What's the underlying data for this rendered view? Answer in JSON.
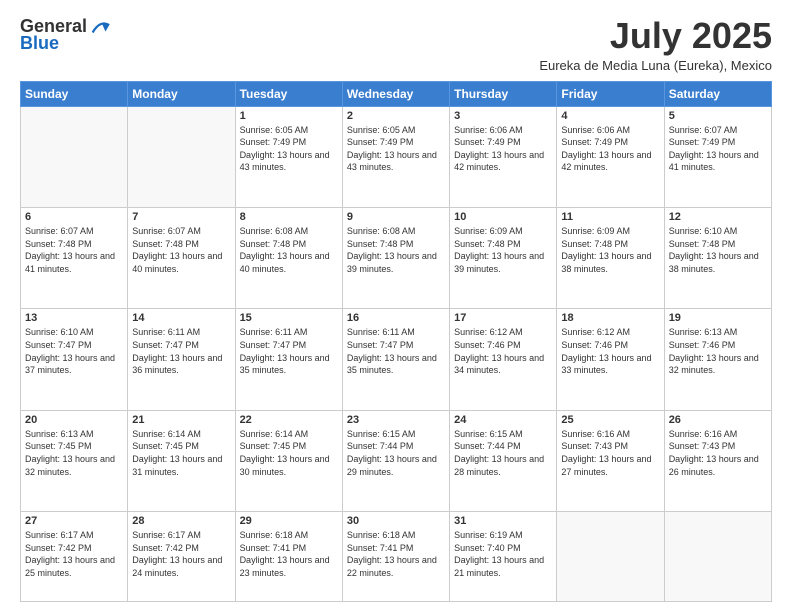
{
  "header": {
    "logo_general": "General",
    "logo_blue": "Blue",
    "month_title": "July 2025",
    "location": "Eureka de Media Luna (Eureka), Mexico"
  },
  "days_of_week": [
    "Sunday",
    "Monday",
    "Tuesday",
    "Wednesday",
    "Thursday",
    "Friday",
    "Saturday"
  ],
  "weeks": [
    [
      {
        "day": "",
        "info": ""
      },
      {
        "day": "",
        "info": ""
      },
      {
        "day": "1",
        "info": "Sunrise: 6:05 AM\nSunset: 7:49 PM\nDaylight: 13 hours and 43 minutes."
      },
      {
        "day": "2",
        "info": "Sunrise: 6:05 AM\nSunset: 7:49 PM\nDaylight: 13 hours and 43 minutes."
      },
      {
        "day": "3",
        "info": "Sunrise: 6:06 AM\nSunset: 7:49 PM\nDaylight: 13 hours and 42 minutes."
      },
      {
        "day": "4",
        "info": "Sunrise: 6:06 AM\nSunset: 7:49 PM\nDaylight: 13 hours and 42 minutes."
      },
      {
        "day": "5",
        "info": "Sunrise: 6:07 AM\nSunset: 7:49 PM\nDaylight: 13 hours and 41 minutes."
      }
    ],
    [
      {
        "day": "6",
        "info": "Sunrise: 6:07 AM\nSunset: 7:48 PM\nDaylight: 13 hours and 41 minutes."
      },
      {
        "day": "7",
        "info": "Sunrise: 6:07 AM\nSunset: 7:48 PM\nDaylight: 13 hours and 40 minutes."
      },
      {
        "day": "8",
        "info": "Sunrise: 6:08 AM\nSunset: 7:48 PM\nDaylight: 13 hours and 40 minutes."
      },
      {
        "day": "9",
        "info": "Sunrise: 6:08 AM\nSunset: 7:48 PM\nDaylight: 13 hours and 39 minutes."
      },
      {
        "day": "10",
        "info": "Sunrise: 6:09 AM\nSunset: 7:48 PM\nDaylight: 13 hours and 39 minutes."
      },
      {
        "day": "11",
        "info": "Sunrise: 6:09 AM\nSunset: 7:48 PM\nDaylight: 13 hours and 38 minutes."
      },
      {
        "day": "12",
        "info": "Sunrise: 6:10 AM\nSunset: 7:48 PM\nDaylight: 13 hours and 38 minutes."
      }
    ],
    [
      {
        "day": "13",
        "info": "Sunrise: 6:10 AM\nSunset: 7:47 PM\nDaylight: 13 hours and 37 minutes."
      },
      {
        "day": "14",
        "info": "Sunrise: 6:11 AM\nSunset: 7:47 PM\nDaylight: 13 hours and 36 minutes."
      },
      {
        "day": "15",
        "info": "Sunrise: 6:11 AM\nSunset: 7:47 PM\nDaylight: 13 hours and 35 minutes."
      },
      {
        "day": "16",
        "info": "Sunrise: 6:11 AM\nSunset: 7:47 PM\nDaylight: 13 hours and 35 minutes."
      },
      {
        "day": "17",
        "info": "Sunrise: 6:12 AM\nSunset: 7:46 PM\nDaylight: 13 hours and 34 minutes."
      },
      {
        "day": "18",
        "info": "Sunrise: 6:12 AM\nSunset: 7:46 PM\nDaylight: 13 hours and 33 minutes."
      },
      {
        "day": "19",
        "info": "Sunrise: 6:13 AM\nSunset: 7:46 PM\nDaylight: 13 hours and 32 minutes."
      }
    ],
    [
      {
        "day": "20",
        "info": "Sunrise: 6:13 AM\nSunset: 7:45 PM\nDaylight: 13 hours and 32 minutes."
      },
      {
        "day": "21",
        "info": "Sunrise: 6:14 AM\nSunset: 7:45 PM\nDaylight: 13 hours and 31 minutes."
      },
      {
        "day": "22",
        "info": "Sunrise: 6:14 AM\nSunset: 7:45 PM\nDaylight: 13 hours and 30 minutes."
      },
      {
        "day": "23",
        "info": "Sunrise: 6:15 AM\nSunset: 7:44 PM\nDaylight: 13 hours and 29 minutes."
      },
      {
        "day": "24",
        "info": "Sunrise: 6:15 AM\nSunset: 7:44 PM\nDaylight: 13 hours and 28 minutes."
      },
      {
        "day": "25",
        "info": "Sunrise: 6:16 AM\nSunset: 7:43 PM\nDaylight: 13 hours and 27 minutes."
      },
      {
        "day": "26",
        "info": "Sunrise: 6:16 AM\nSunset: 7:43 PM\nDaylight: 13 hours and 26 minutes."
      }
    ],
    [
      {
        "day": "27",
        "info": "Sunrise: 6:17 AM\nSunset: 7:42 PM\nDaylight: 13 hours and 25 minutes."
      },
      {
        "day": "28",
        "info": "Sunrise: 6:17 AM\nSunset: 7:42 PM\nDaylight: 13 hours and 24 minutes."
      },
      {
        "day": "29",
        "info": "Sunrise: 6:18 AM\nSunset: 7:41 PM\nDaylight: 13 hours and 23 minutes."
      },
      {
        "day": "30",
        "info": "Sunrise: 6:18 AM\nSunset: 7:41 PM\nDaylight: 13 hours and 22 minutes."
      },
      {
        "day": "31",
        "info": "Sunrise: 6:19 AM\nSunset: 7:40 PM\nDaylight: 13 hours and 21 minutes."
      },
      {
        "day": "",
        "info": ""
      },
      {
        "day": "",
        "info": ""
      }
    ]
  ]
}
